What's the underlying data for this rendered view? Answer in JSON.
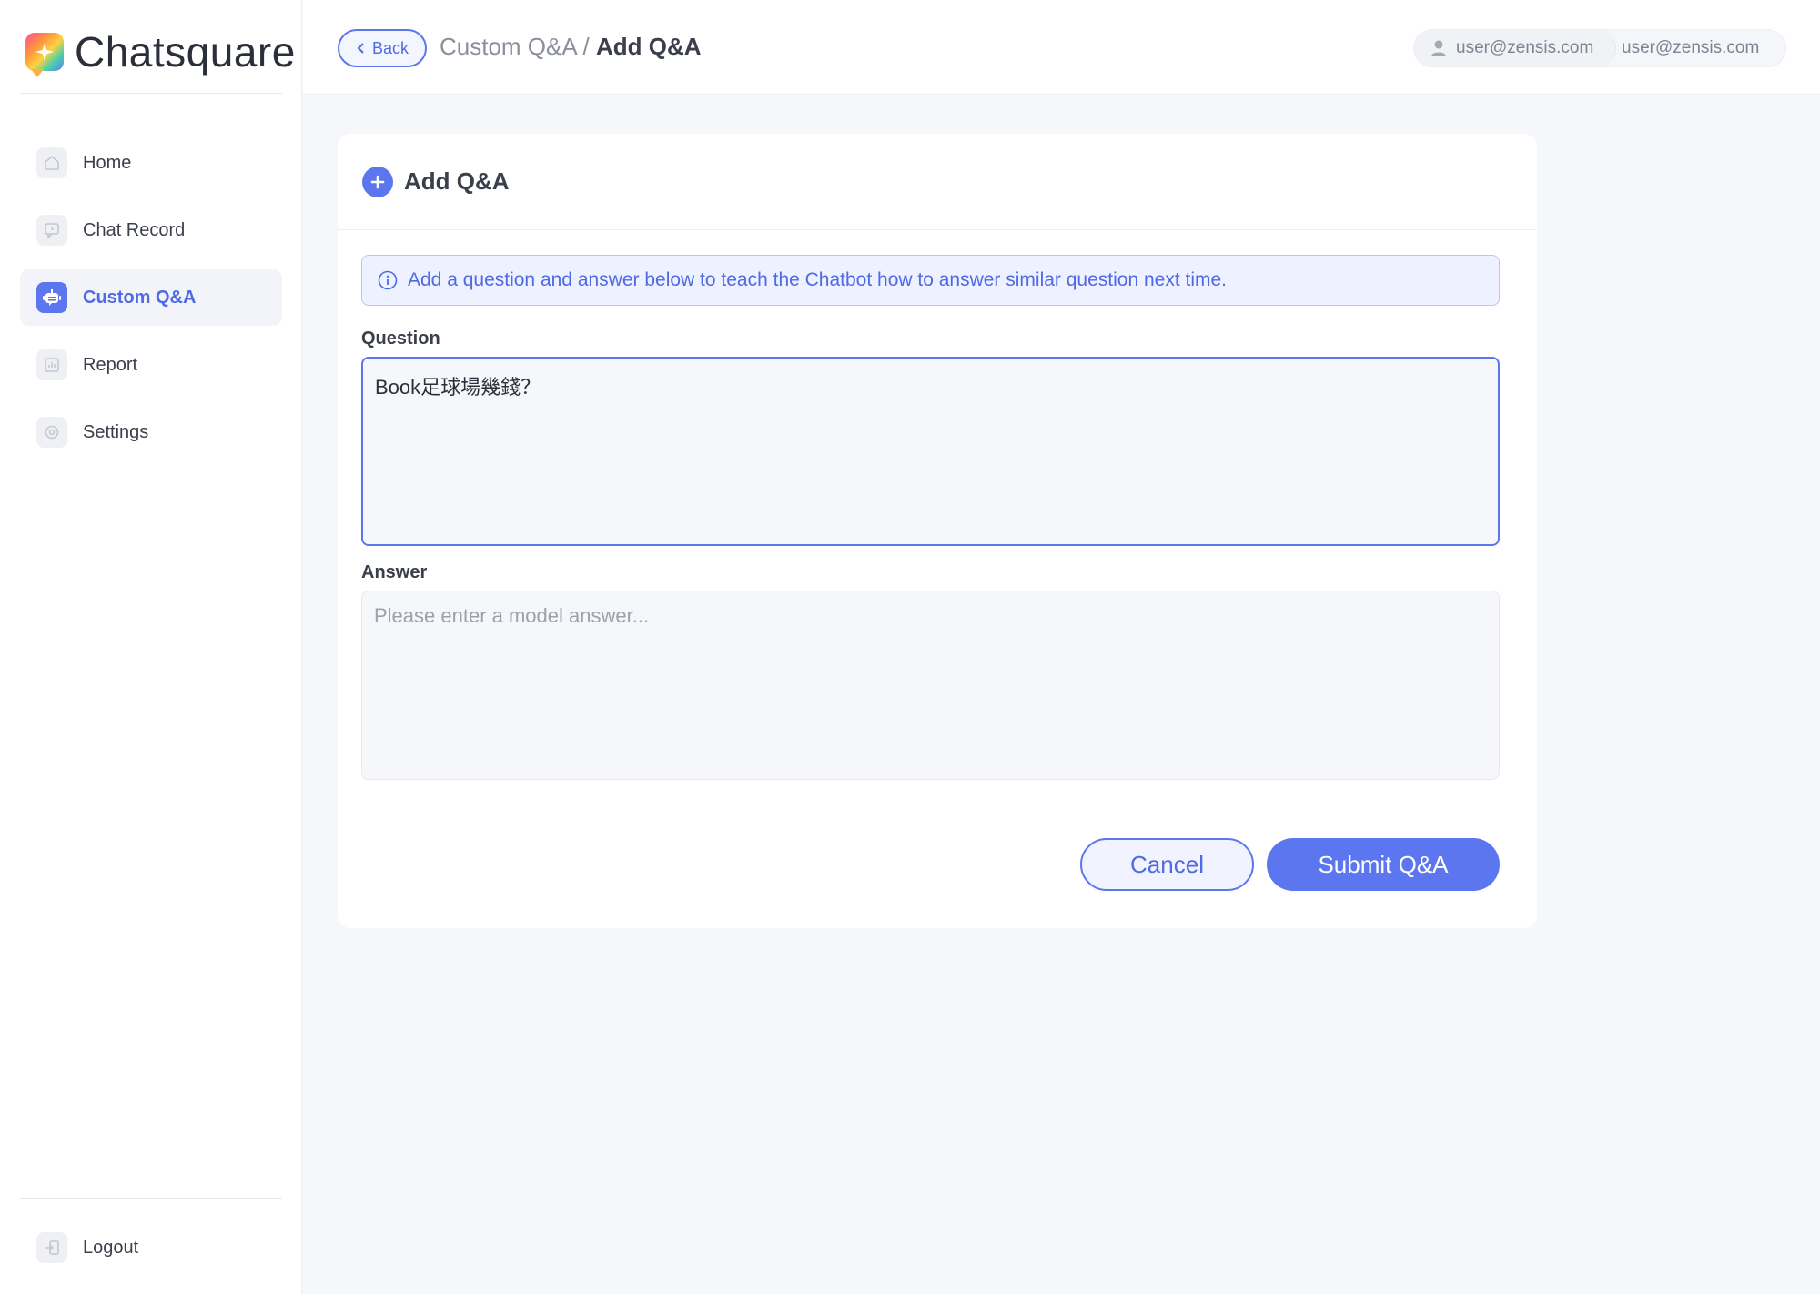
{
  "app": {
    "name": "Chatsquare"
  },
  "sidebar": {
    "items": [
      {
        "label": "Home",
        "icon": "home-icon"
      },
      {
        "label": "Chat Record",
        "icon": "chat-record-icon"
      },
      {
        "label": "Custom Q&A",
        "icon": "robot-icon",
        "active": true
      },
      {
        "label": "Report",
        "icon": "report-icon"
      },
      {
        "label": "Settings",
        "icon": "settings-icon"
      }
    ],
    "logout_label": "Logout"
  },
  "header": {
    "back_label": "Back",
    "breadcrumb_parent": "Custom Q&A",
    "breadcrumb_separator": " / ",
    "breadcrumb_current": "Add Q&A",
    "user_email_1": "user@zensis.com",
    "user_email_2": "user@zensis.com"
  },
  "card": {
    "title": "Add Q&A",
    "info_text": "Add a question and answer below to teach the Chatbot how to answer similar question next time.",
    "question_label": "Question",
    "question_value": "Book足球場幾錢？",
    "answer_label": "Answer",
    "answer_value": "",
    "answer_placeholder": "Please enter a model answer...",
    "cancel_label": "Cancel",
    "submit_label": "Submit Q&A"
  },
  "colors": {
    "accent": "#5b76ee",
    "background": "#f6f7fb",
    "info_bg": "#eef1ff"
  }
}
